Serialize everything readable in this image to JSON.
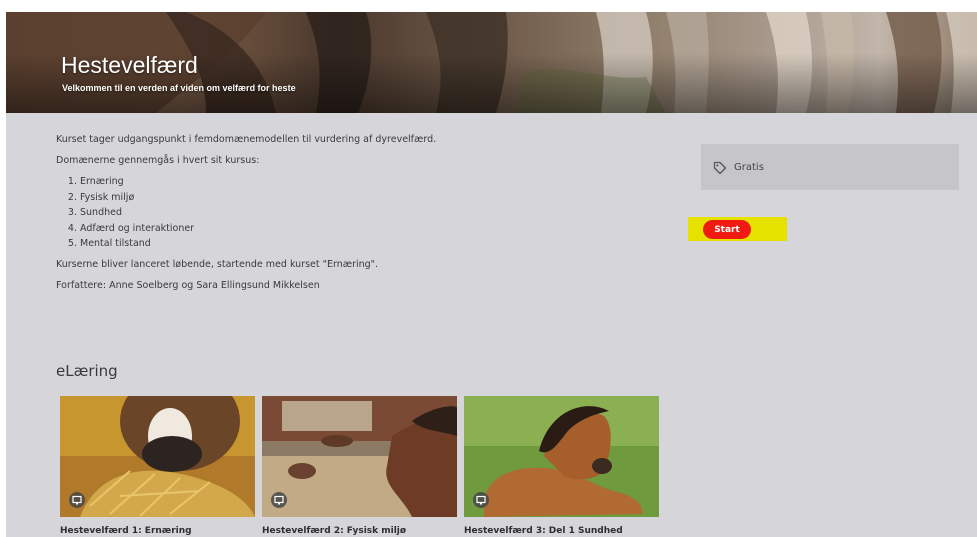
{
  "hero": {
    "title": "Hestevelfærd",
    "subtitle": "Velkommen til en verden af viden om velfærd for heste"
  },
  "description": {
    "intro": "Kurset tager udgangspunkt i femdomænemodellen til vurdering af dyrevelfærd.",
    "lead": "Domænerne gennemgås i hvert sit kursus:",
    "domains": [
      "Ernæring",
      "Fysisk miljø",
      "Sundhed",
      "Adfærd og interaktioner",
      "Mental tilstand"
    ],
    "launch_note": "Kurserne bliver lanceret løbende, startende med kurset \"Ernæring\".",
    "authors": "Forfattere: Anne Soelberg og Sara Ellingsund Mikkelsen"
  },
  "sidebar": {
    "price_label": "Gratis",
    "price_icon": "tag-icon",
    "start_label": "Start",
    "start_color": "#f01a12",
    "highlight_color": "#e5e200"
  },
  "elearning": {
    "heading": "eLæring",
    "icon": "elearning-icon",
    "courses": [
      {
        "title": "Hestevelfærd 1: Ernæring"
      },
      {
        "title": "Hestevelfærd 2: Fysisk miljø"
      },
      {
        "title": "Hestevelfærd 3: Del 1 Sundhed"
      }
    ]
  }
}
